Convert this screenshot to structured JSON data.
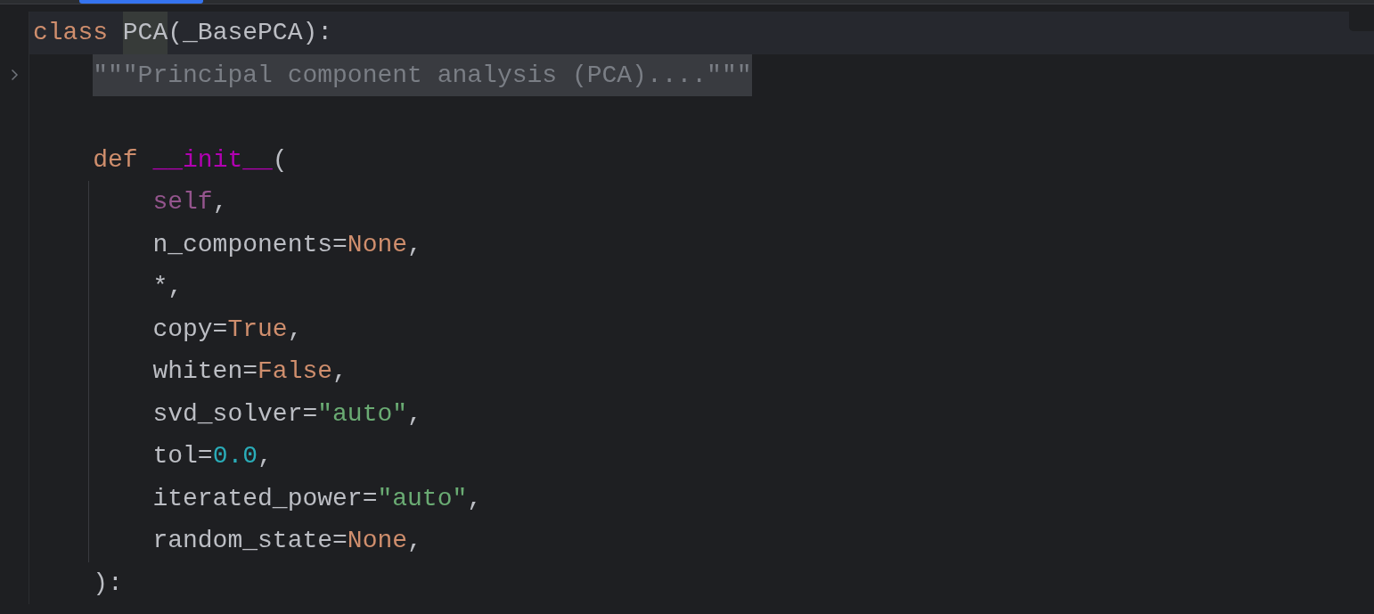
{
  "editor": {
    "lines": [
      {
        "current": true,
        "folded": false,
        "tokens": [
          {
            "text": "class",
            "kind": "declaration",
            "highlighted": false
          },
          {
            "text": "PCA",
            "kind": "plain",
            "highlighted": true
          },
          {
            "text": "(_BasePCA):",
            "kind": "plain",
            "highlighted": false
          }
        ],
        "children": [
          {
            "current": false,
            "folded": true,
            "tokens": [
              {
                "text": "\"\"\"Principal component analysis (PCA)....\"\"\"",
                "kind": "docstring"
              }
            ]
          },
          {
            "current": false,
            "folded": false
          },
          {
            "current": false,
            "folded": false,
            "tokens": [
              {
                "text": "def",
                "kind": "declaration",
                "highlighted": false
              },
              {
                "text": "__init__",
                "kind": "magic",
                "highlighted": false
              },
              {
                "text": "(",
                "kind": "plain",
                "highlighted": false
              }
            ],
            "children": [
              {
                "current": false,
                "folded": false,
                "tokens": [
                  {
                    "text": "self",
                    "kind": "self",
                    "highlighted": false
                  },
                  {
                    "text": ",",
                    "kind": "plain",
                    "highlighted": false
                  }
                ]
              },
              {
                "current": false,
                "folded": false,
                "tokens": [
                  {
                    "text": "n_components=",
                    "kind": "plain",
                    "highlighted": false
                  },
                  {
                    "text": "None",
                    "kind": "keyword",
                    "highlighted": false
                  },
                  {
                    "text": ",",
                    "kind": "plain",
                    "highlighted": false
                  }
                ]
              },
              {
                "current": false,
                "folded": false,
                "tokens": [
                  {
                    "text": "*,",
                    "kind": "plain",
                    "highlighted": false
                  }
                ]
              },
              {
                "current": false,
                "folded": false,
                "tokens": [
                  {
                    "text": "copy=",
                    "kind": "plain",
                    "highlighted": false
                  },
                  {
                    "text": "True",
                    "kind": "keyword",
                    "highlighted": false
                  },
                  {
                    "text": ",",
                    "kind": "plain",
                    "highlighted": false
                  }
                ]
              },
              {
                "current": false,
                "folded": false,
                "tokens": [
                  {
                    "text": "whiten=",
                    "kind": "plain",
                    "highlighted": false
                  },
                  {
                    "text": "False",
                    "kind": "keyword",
                    "highlighted": false
                  },
                  {
                    "text": ",",
                    "kind": "plain",
                    "highlighted": false
                  }
                ]
              },
              {
                "current": false,
                "folded": false,
                "tokens": [
                  {
                    "text": "svd_solver=",
                    "kind": "plain",
                    "highlighted": false
                  },
                  {
                    "text": "\"auto\"",
                    "kind": "string",
                    "highlighted": false
                  },
                  {
                    "text": ",",
                    "kind": "plain",
                    "highlighted": false
                  }
                ]
              },
              {
                "current": false,
                "folded": false,
                "tokens": [
                  {
                    "text": "tol=",
                    "kind": "plain",
                    "highlighted": false
                  },
                  {
                    "text": "0.0",
                    "kind": "number",
                    "highlighted": false
                  },
                  {
                    "text": ",",
                    "kind": "plain",
                    "highlighted": false
                  }
                ]
              },
              {
                "current": false,
                "folded": false,
                "tokens": [
                  {
                    "text": "iterated_power=",
                    "kind": "plain",
                    "highlighted": false
                  },
                  {
                    "text": "\"auto\"",
                    "kind": "string",
                    "highlighted": false
                  },
                  {
                    "text": ",",
                    "kind": "plain",
                    "highlighted": false
                  }
                ]
              },
              {
                "current": false,
                "folded": false,
                "tokens": [
                  {
                    "text": "random_state=",
                    "kind": "plain",
                    "highlighted": false
                  },
                  {
                    "text": "None",
                    "kind": "keyword",
                    "highlighted": false
                  },
                  {
                    "text": ",",
                    "kind": "plain",
                    "highlighted": false
                  }
                ]
              }
            ]
          },
          {
            "current": false,
            "folded": false,
            "tokens": [
              {
                "text": "):",
                "kind": "plain",
                "highlighted": false
              }
            ]
          }
        ]
      }
    ]
  }
}
